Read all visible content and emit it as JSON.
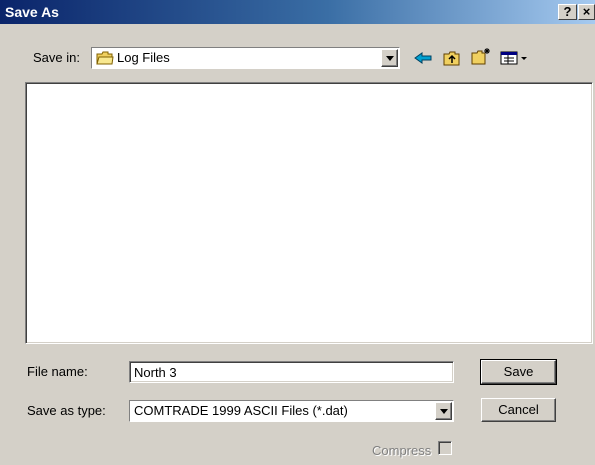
{
  "window": {
    "title": "Save As",
    "help_label": "?",
    "close_label": "×"
  },
  "save_in": {
    "label": "Save in:",
    "value": "Log Files"
  },
  "toolbar": {
    "icons": [
      "back-icon",
      "up-folder-icon",
      "new-folder-icon",
      "view-menu-icon"
    ]
  },
  "file_list": {
    "items": []
  },
  "file_name": {
    "label": "File name:",
    "value": "North 3"
  },
  "save_as_type": {
    "label": "Save as type:",
    "value": "COMTRADE 1999 ASCII Files (*.dat)"
  },
  "buttons": {
    "save": "Save",
    "cancel": "Cancel"
  },
  "compress": {
    "label": "Compress",
    "checked": false,
    "enabled": false
  },
  "colors": {
    "title_bar_start": "#0a246a",
    "title_bar_end": "#a6caf0",
    "dialog_bg": "#d4d0c8"
  }
}
